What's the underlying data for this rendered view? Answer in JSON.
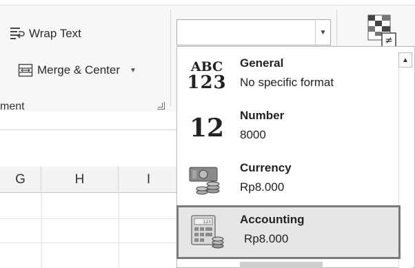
{
  "ribbon": {
    "wrap_text_label": "Wrap Text",
    "merge_center_label": "Merge & Center",
    "group_label": "ment",
    "number_format_value": ""
  },
  "sheet": {
    "columns": [
      "G",
      "H",
      "I"
    ]
  },
  "number_format_menu": {
    "items": [
      {
        "title": "General",
        "sample": "No specific format",
        "icon": "abc-123-icon"
      },
      {
        "title": "Number",
        "sample": "8000",
        "icon": "number-12-icon"
      },
      {
        "title": "Currency",
        "sample": "Rp8.000",
        "icon": "currency-icon"
      },
      {
        "title": "Accounting",
        "sample": "Rp8.000",
        "icon": "accounting-calculator-icon",
        "selected": true
      }
    ],
    "general_icon_top": "ABC",
    "general_icon_bottom": "123",
    "number_icon_text": "12"
  },
  "colors": {
    "selected_border": "#7a7a7a",
    "selected_bg": "#e6e6e6",
    "ribbon_bg": "#f7f7f7"
  }
}
